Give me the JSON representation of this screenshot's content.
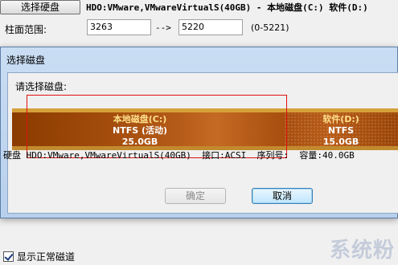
{
  "background": {
    "select_disk_button": "选择硬盘",
    "disk_info": "HDO:VMware,VMwareVirtualS(40GB) - 本地磁盘(C:) 软件(D:)",
    "range_label": "柱面范围:",
    "range_start": "3263",
    "range_arrow": "-->",
    "range_end": "5220",
    "range_hint": "(0-5221)",
    "show_normal_tracks_label": "显示正常磁道",
    "watermark": "系统粉"
  },
  "dialog": {
    "title": "选择磁盘",
    "prompt": "请选择磁盘:",
    "partitions": [
      {
        "name": "本地磁盘(C:)",
        "fs": "NTFS (活动)",
        "size": "25.0GB",
        "selected": true,
        "color": "#a84e0e"
      },
      {
        "name": "软件(D:)",
        "fs": "NTFS",
        "size": "15.0GB",
        "selected": false,
        "color": "#b85c18"
      }
    ],
    "disk_line": {
      "disk": "硬盘 HDO:VMware,VMwareVirtualS(40GB)",
      "interface": "接口:ACSI",
      "serial": "序列号:",
      "capacity": "容量:40.0GB"
    },
    "ok_label": "确定",
    "cancel_label": "取消"
  },
  "colors": {
    "selection_border": "#e01010",
    "dialog_frame": "#b8d0ec",
    "partition_top_stripe": "#d6a13a"
  }
}
